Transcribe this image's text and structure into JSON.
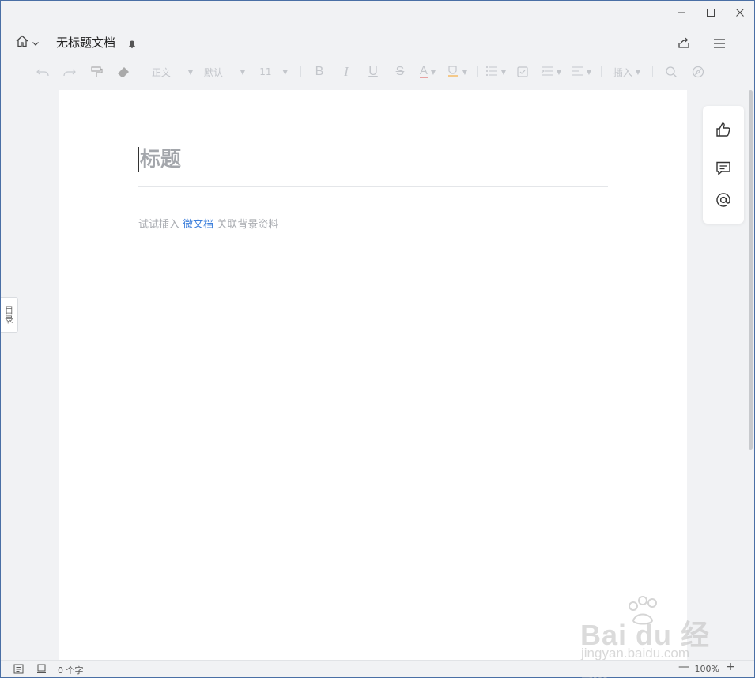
{
  "window": {
    "controls": [
      "minimize",
      "maximize",
      "close"
    ]
  },
  "header": {
    "doc_title": "无标题文档"
  },
  "toolbar": {
    "style_label": "正文",
    "font_label": "默认",
    "size_label": "11",
    "bold": "B",
    "italic": "I",
    "underline": "U",
    "strike": "S",
    "font_color": "A",
    "insert_label": "插入"
  },
  "document": {
    "title_placeholder": "标题",
    "hint_prefix": "试试插入",
    "hint_link": "微文档",
    "hint_suffix": "关联背景资料"
  },
  "toc_tab": {
    "char1": "目",
    "char2": "录"
  },
  "statusbar": {
    "word_count": "0 个字",
    "zoom": "100%"
  },
  "watermark": {
    "brand": "Bai du 经验",
    "url": "jingyan.baidu.com"
  },
  "colors": {
    "link": "#3d7fdb",
    "page_bg": "#f1f2f4",
    "accent_red": "#e05a5a",
    "accent_orange": "#f0a040"
  }
}
